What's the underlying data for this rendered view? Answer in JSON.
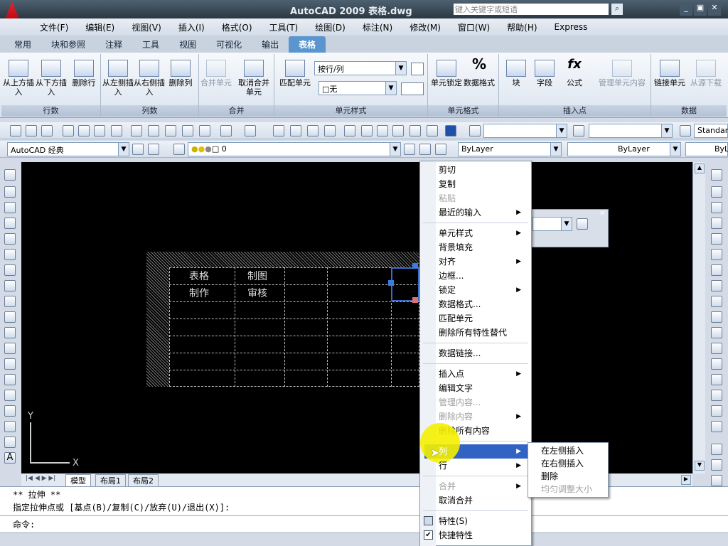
{
  "title": {
    "app": "AutoCAD 2009 表格.dwg",
    "search_placeholder": "键入关键字或短语"
  },
  "menu": [
    "文件(F)",
    "编辑(E)",
    "视图(V)",
    "插入(I)",
    "格式(O)",
    "工具(T)",
    "绘图(D)",
    "标注(N)",
    "修改(M)",
    "窗口(W)",
    "帮助(H)",
    "Express"
  ],
  "tabs": [
    "常用",
    "块和参照",
    "注释",
    "工具",
    "视图",
    "可视化",
    "输出",
    "表格"
  ],
  "ribbon": {
    "rows": {
      "label": "行数",
      "b1": "从上方插入",
      "b2": "从下方插入",
      "b3": "删除行"
    },
    "cols": {
      "label": "列数",
      "b1": "从左侧插入",
      "b2": "从右侧插入",
      "b3": "删除列"
    },
    "merge": {
      "label": "合并",
      "b1": "合并单元",
      "b2": "取消合并单元"
    },
    "style": {
      "label": "单元样式",
      "b1": "匹配单元",
      "combo1": "按行/列",
      "combo2": "□无"
    },
    "format": {
      "label": "单元格式",
      "b1": "单元锁定",
      "b2": "数据格式"
    },
    "insert": {
      "label": "插入点",
      "b1": "块",
      "b2": "字段",
      "b3": "公式",
      "b4": "管理单元内容"
    },
    "data": {
      "label": "数据",
      "b1": "链接单元",
      "b2": "从源下载"
    }
  },
  "toolbar2": {
    "workspace": "AutoCAD 经典",
    "layer": "0",
    "color": "ByLayer",
    "linetype": "ByLayer",
    "lineweight": "ByL",
    "style": "Standar"
  },
  "table_cells": {
    "c1": "表格",
    "c2": "制图",
    "c3": "制作",
    "c4": "审核"
  },
  "layouts": [
    "模型",
    "布局1",
    "布局2"
  ],
  "axis": {
    "x": "X",
    "y": "Y"
  },
  "command": {
    "line1": "** 拉伸 **",
    "line2": "指定拉伸点或 [基点(B)/复制(C)/放弃(U)/退出(X)]:",
    "line3": "命令:"
  },
  "context_menu": {
    "cut": "剪切",
    "copy": "复制",
    "paste": "粘贴",
    "recent": "最近的输入",
    "cell_style": "单元样式",
    "bg_fill": "背景填充",
    "align": "对齐",
    "border": "边框...",
    "lock": "锁定",
    "data_format": "数据格式...",
    "match": "匹配单元",
    "remove_over": "删除所有特性替代",
    "data_link": "数据链接...",
    "insert_point": "插入点",
    "edit_text": "编辑文字",
    "manage_content": "管理内容...",
    "delete_content": "删除内容",
    "delete_all": "删除所有内容",
    "column": "列",
    "row": "行",
    "merge": "合并",
    "unmerge": "取消合并",
    "properties": "特性(S)",
    "quick_props": "快捷特性"
  },
  "submenu": {
    "left": "在左侧插入",
    "right": "在右侧插入",
    "delete": "删除",
    "even": "均匀调整大小"
  },
  "colors": {
    "selected": "#3163c5",
    "highlight": "#f5f000"
  }
}
